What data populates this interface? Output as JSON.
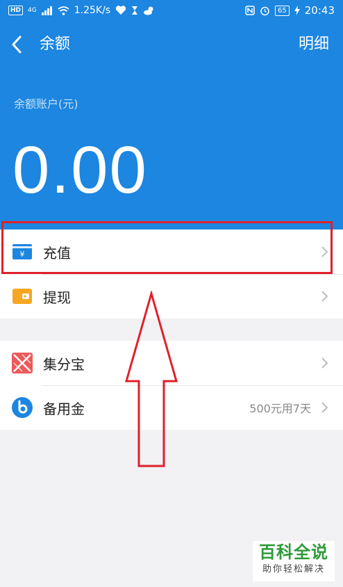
{
  "status_bar": {
    "hd": "HD",
    "net": "4G",
    "speed": "1.25K/s",
    "battery": "65",
    "time": "20:43"
  },
  "header": {
    "title": "余额",
    "detail_label": "明细",
    "account_label": "余额账户(元)",
    "balance": "0.00"
  },
  "menu": {
    "recharge": "充值",
    "withdraw": "提现",
    "jifenbao": "集分宝",
    "beiyongjin": "备用金",
    "beiyongjin_note": "500元用7天"
  },
  "watermark": {
    "title": "百科全说",
    "subtitle": "助你轻松解决"
  },
  "colors": {
    "primary": "#1c86e0",
    "annotation": "#e0202a",
    "recharge_icon": "#1c86e0",
    "withdraw_icon": "#f5a623",
    "jifenbao_icon": "#ec5a5a",
    "watermark_green": "#2e9a3a"
  }
}
